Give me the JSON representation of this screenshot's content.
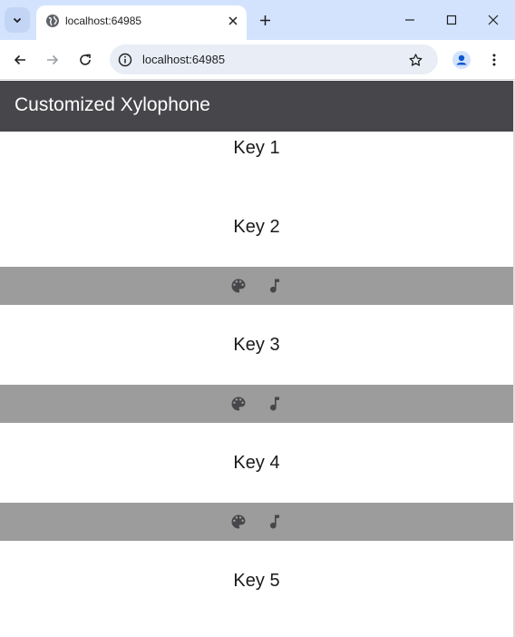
{
  "browser": {
    "tab_title": "localhost:64985",
    "url": "localhost:64985"
  },
  "app": {
    "title": "Customized Xylophone",
    "appbar_color": "#47474b",
    "toolbar_color": "#9c9c9c",
    "keys": [
      {
        "label": "Key 1"
      },
      {
        "label": "Key 2"
      },
      {
        "label": "Key 3"
      },
      {
        "label": "Key 4"
      },
      {
        "label": "Key 5"
      }
    ],
    "key_tools": [
      "palette-icon",
      "music-note-icon"
    ]
  }
}
